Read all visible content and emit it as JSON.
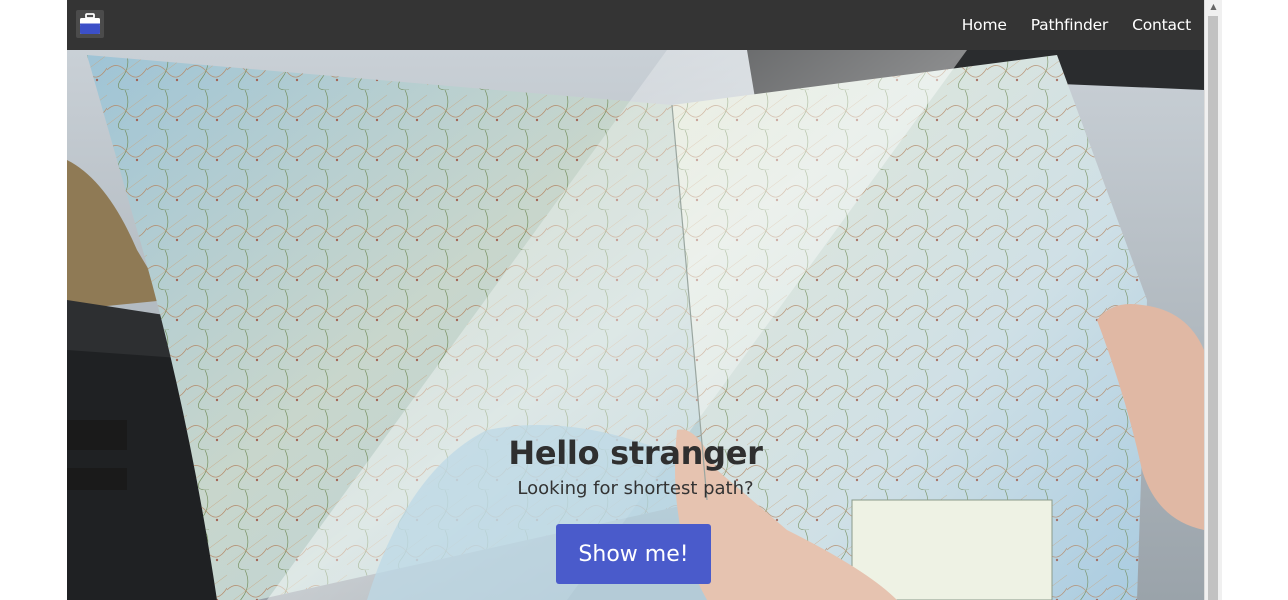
{
  "navbar": {
    "brand_icon": "briefcase-icon",
    "links": [
      "Home",
      "Pathfinder",
      "Contact"
    ]
  },
  "hero": {
    "background": "road-map-photo",
    "title": "Hello stranger",
    "subtitle": "Looking for shortest path?",
    "button_label": "Show me!"
  },
  "colors": {
    "navbar_bg": "#343434",
    "button_bg": "#4a5bcb",
    "nav_text": "#ffffff"
  }
}
